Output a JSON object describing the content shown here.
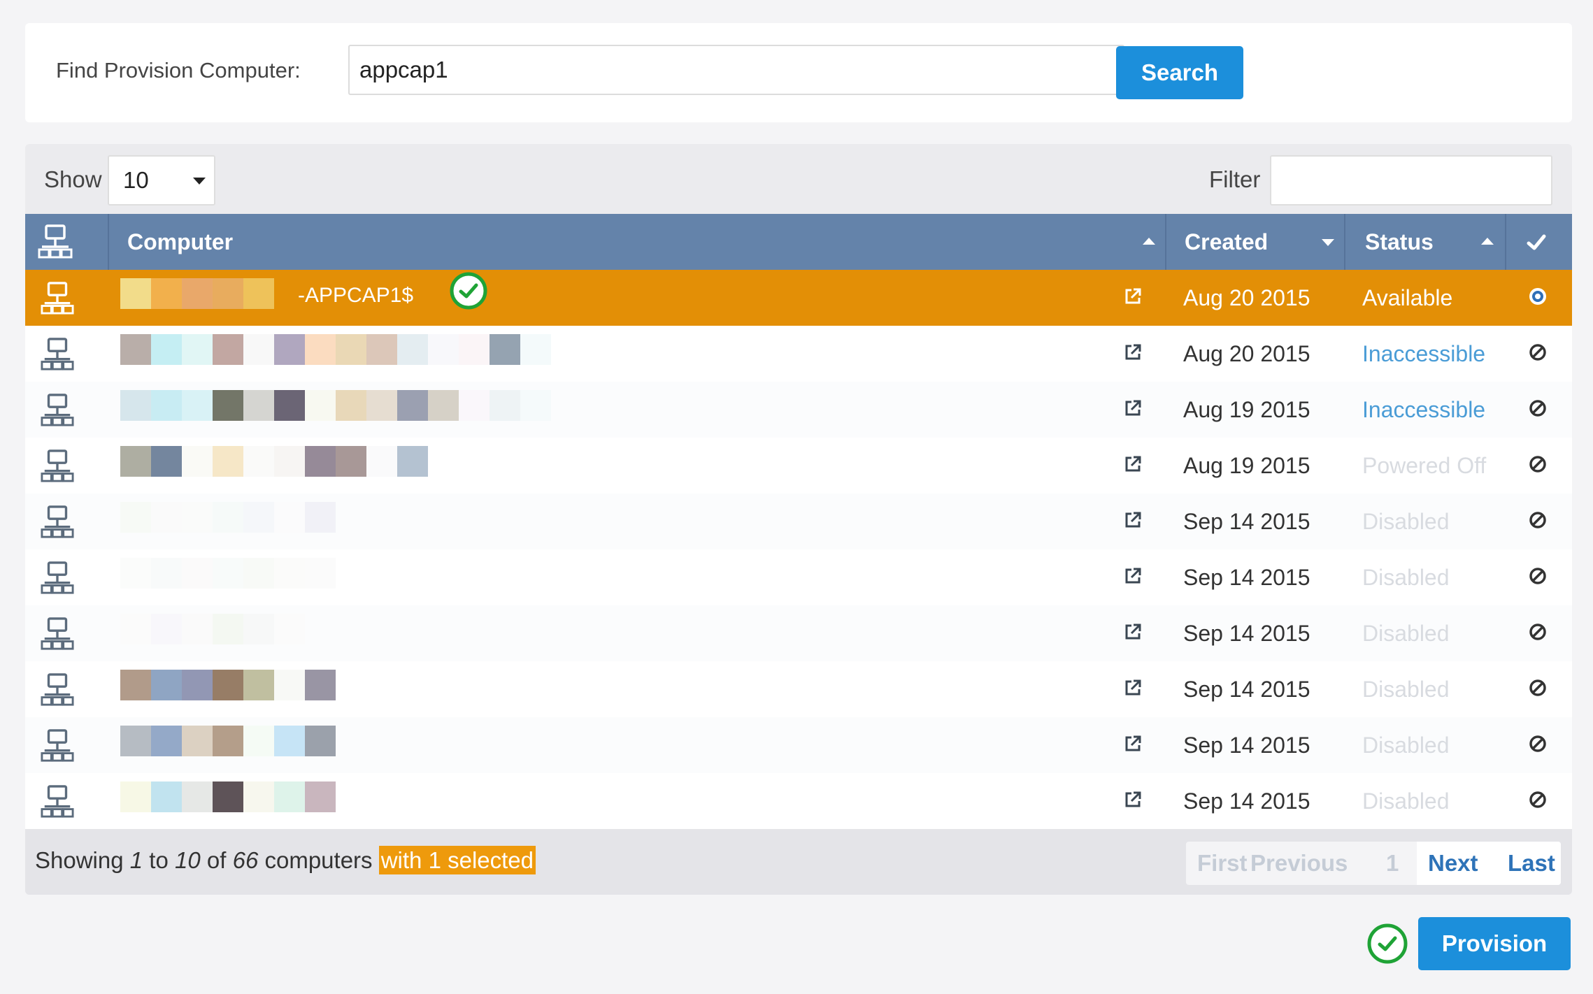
{
  "search": {
    "label": "Find Provision Computer:",
    "value": "appcap1",
    "button_label": "Search"
  },
  "grid": {
    "show_label": "Show",
    "page_size": "10",
    "filter_label": "Filter",
    "filter_value": "",
    "columns": {
      "computer": "Computer",
      "created": "Created",
      "status": "Status"
    },
    "rows": [
      {
        "name_suffix": "-APPCAP1$",
        "created": "Aug 20 2015",
        "status": "Available",
        "selected": true,
        "blocks": [
          "#f2dc8a",
          "#f2b04c",
          "#e9a86a",
          "#e8ac5e",
          "#eec25a"
        ]
      },
      {
        "name_suffix": "",
        "created": "Aug 20 2015",
        "status": "Inaccessible",
        "selected": false,
        "blocks": [
          "#b9aea9",
          "#c5eef3",
          "#e1f6f5",
          "#c2a7a2",
          "#f8f8f8",
          "#b0a7bf",
          "#fbdcc0",
          "#ead8b5",
          "#dcc7b9",
          "#e4edf1",
          "#f8f8fb",
          "#fbf5f7",
          "#95a3b1",
          "#f4fafb"
        ]
      },
      {
        "name_suffix": "",
        "created": "Aug 19 2015",
        "status": "Inaccessible",
        "selected": false,
        "blocks": [
          "#d6e6ec",
          "#c8ecf3",
          "#d9f2f6",
          "#737668",
          "#d5d5d1",
          "#6b6575",
          "#f8f9f1",
          "#e8d8b9",
          "#e6ddd1",
          "#9ba0b1",
          "#d6d1c7",
          "#faf7fb",
          "#eef3f5",
          "#f5fafb"
        ]
      },
      {
        "name_suffix": "",
        "created": "Aug 19 2015",
        "status": "Powered Off",
        "selected": false,
        "blocks": [
          "#aeaea2",
          "#74869e",
          "#fafaf6",
          "#f6e7c7",
          "#fafaf9",
          "#f7f5f3",
          "#968a98",
          "#a89897",
          "#fafafb",
          "#b4c2d1"
        ]
      },
      {
        "name_suffix": "",
        "created": "Sep 14 2015",
        "status": "Disabled",
        "selected": false,
        "blocks": [
          "#f7faf6",
          "#fafafa",
          "#fafbfa",
          "#f6faf9",
          "#f5f7fa",
          "#fbfbfc",
          "#f1f1f7"
        ]
      },
      {
        "name_suffix": "",
        "created": "Sep 14 2015",
        "status": "Disabled",
        "selected": false,
        "blocks": [
          "#fbfcfb",
          "#f8fafa",
          "#fbfafa",
          "#f8fbfa",
          "#f8faf7",
          "#fbfbfa",
          "#fbfbfb"
        ]
      },
      {
        "name_suffix": "",
        "created": "Sep 14 2015",
        "status": "Disabled",
        "selected": false,
        "blocks": [
          "#fbfbfb",
          "#f8f7fb",
          "#fafafa",
          "#f4f8f2",
          "#f7f8f8",
          "#fbfbfb"
        ]
      },
      {
        "name_suffix": "",
        "created": "Sep 14 2015",
        "status": "Disabled",
        "selected": false,
        "blocks": [
          "#b19b8a",
          "#8fa5c3",
          "#9297b4",
          "#977d66",
          "#c0bfa0",
          "#f8f9f6",
          "#9995a4"
        ]
      },
      {
        "name_suffix": "",
        "created": "Sep 14 2015",
        "status": "Disabled",
        "selected": false,
        "blocks": [
          "#b6bcc3",
          "#94a9c8",
          "#dcd1c2",
          "#b49e8a",
          "#f5fbf5",
          "#c6e4f6",
          "#9ba1ab"
        ]
      },
      {
        "name_suffix": "",
        "created": "Sep 14 2015",
        "status": "Disabled",
        "selected": false,
        "blocks": [
          "#f7f8e6",
          "#c1e3ef",
          "#e6e8e6",
          "#5e5358",
          "#f7f7ee",
          "#def3ea",
          "#c9b6be"
        ]
      }
    ],
    "status_colors": {
      "Available": "#ffffff",
      "Inaccessible": "#4a9cd6",
      "Powered Off": "#d8dbe0",
      "Disabled": "#d8dbe0"
    },
    "footer": {
      "prefix": "Showing",
      "from": "1",
      "to_word": "to",
      "to": "10",
      "of_word": "of",
      "total": "66",
      "noun": "computers",
      "selected_text": "with 1 selected"
    },
    "pager": {
      "first": "First",
      "previous": "Previous",
      "page": "1",
      "next": "Next",
      "last": "Last"
    }
  },
  "provision": {
    "button_label": "Provision"
  },
  "icons": {
    "header_computer": "computer-network-icon",
    "row_computer": "computer-network-icon",
    "open": "external-link-icon",
    "select_selected": "radio-selected-icon",
    "select_unavailable": "not-allowed-icon",
    "check": "check-circle-icon",
    "header_check": "checkmark-icon"
  },
  "colors": {
    "accent": "#1c8fdb",
    "header": "#6483aa",
    "selected_row": "#e38f06",
    "check_green": "#1fa336"
  }
}
